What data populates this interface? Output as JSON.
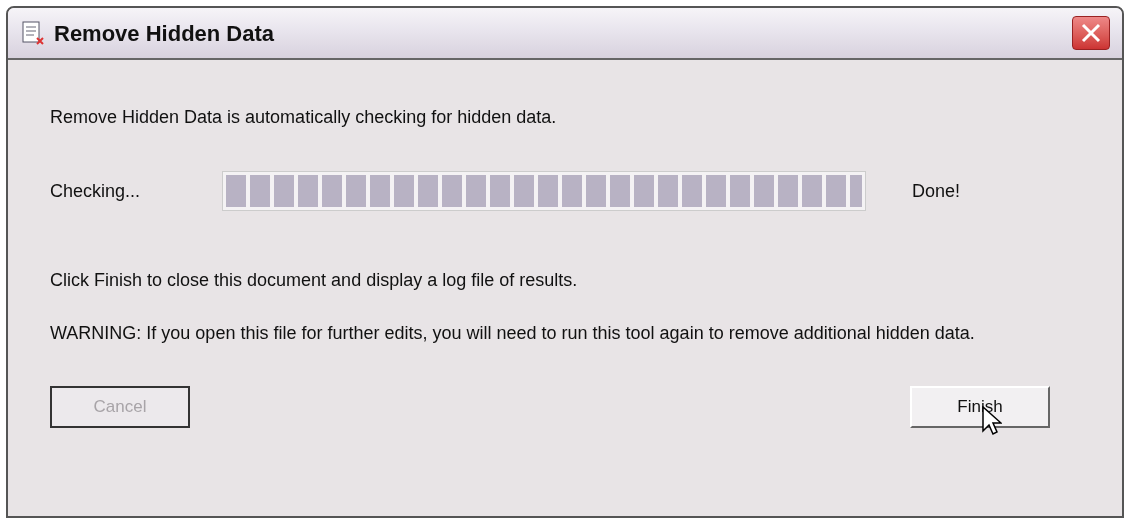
{
  "window": {
    "title": "Remove Hidden Data"
  },
  "intro": "Remove Hidden Data is automatically checking for hidden data.",
  "progress": {
    "label": "Checking...",
    "level": 1,
    "status": "Done!"
  },
  "info": "Click Finish to close this document and display a log file of results.",
  "warning": "WARNING: If you open this file for further edits, you will need to run this tool again to remove additional hidden data.",
  "buttons": [
    {
      "label": "Cancel",
      "disabled": true
    },
    {
      "label": "Finish",
      "disabled": false
    }
  ]
}
